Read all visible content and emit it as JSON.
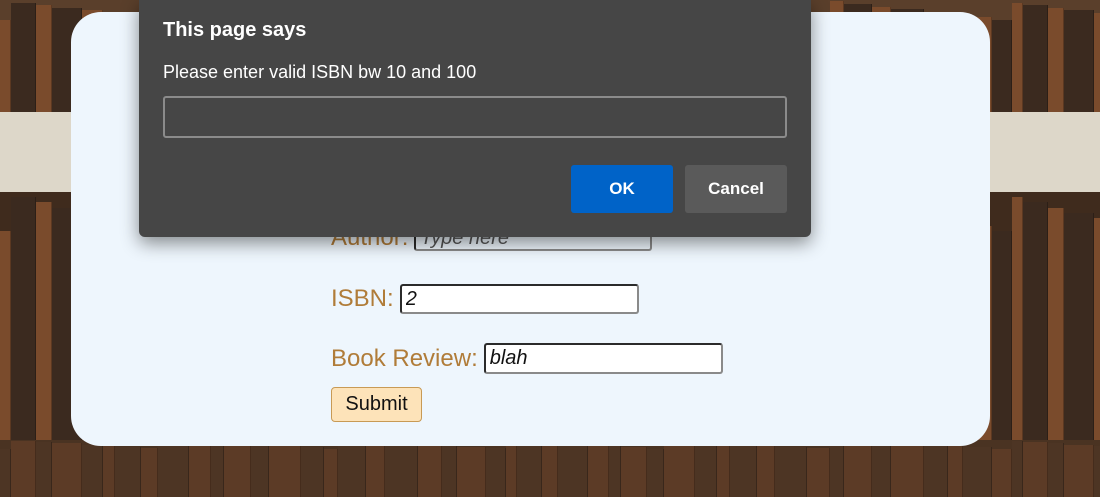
{
  "dialog": {
    "title": "This page says",
    "message": "Please enter valid ISBN bw 10 and 100",
    "input_value": "",
    "ok_label": "OK",
    "cancel_label": "Cancel",
    "ok_color": "#0063c8"
  },
  "form": {
    "author_label": "Author:",
    "author_placeholder": "Type here",
    "isbn_label": "ISBN:",
    "isbn_value": "2",
    "review_label": "Book Review:",
    "review_value": "blah",
    "submit_label": "Submit",
    "label_color": "#b07c39"
  },
  "background": {
    "card_color": "#eef6fd"
  }
}
